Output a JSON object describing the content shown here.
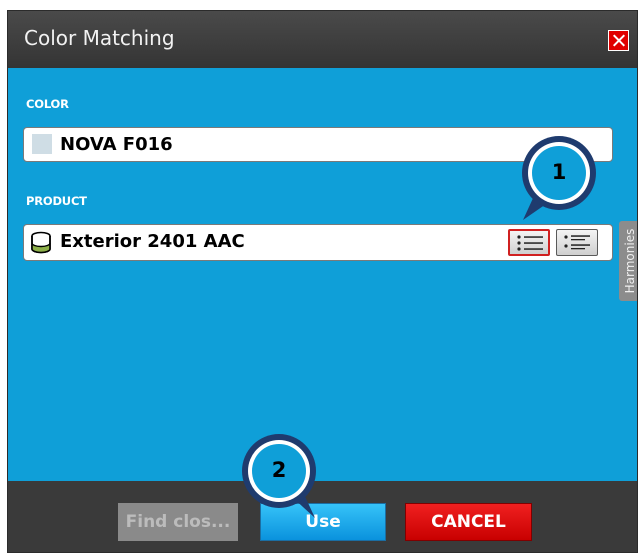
{
  "dialog": {
    "title": "Color Matching"
  },
  "color_section": {
    "label": "COLOR",
    "value": "NOVA F016",
    "swatch_color": "#cfdde5"
  },
  "product_section": {
    "label": "PRODUCT",
    "value": "Exterior 2401 AAC"
  },
  "side_tab": {
    "label": "Harmonies"
  },
  "footer": {
    "find_label": "Find clos...",
    "use_label": "Use",
    "cancel_label": "CANCEL"
  },
  "callouts": {
    "first": "1",
    "second": "2"
  },
  "colors": {
    "accent": "#0f9fd8",
    "titlebar": "#3c3c3c",
    "danger": "#e00000"
  }
}
